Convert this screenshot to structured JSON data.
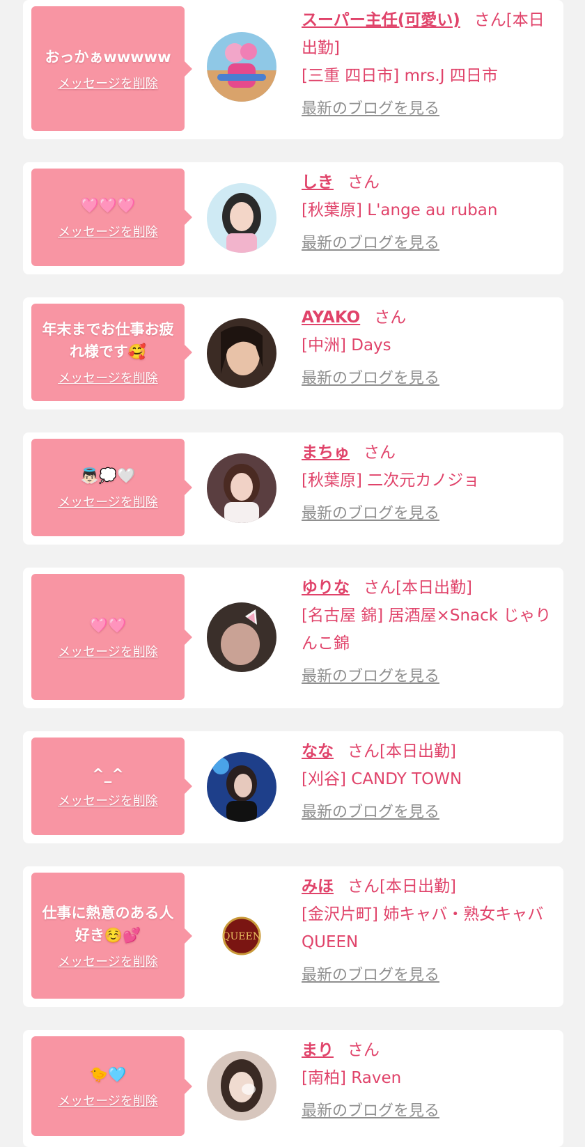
{
  "items": [
    {
      "message": "おっかぁwwwww",
      "delete_label": "メッセージを削除",
      "name": "スーパー主任(可愛い)",
      "honorific": "さん[本日出勤]",
      "shop": "[三重 四日市] mrs.J 四日市",
      "blog_label": "最新のブログを見る"
    },
    {
      "message": "🩷🩷🩷",
      "delete_label": "メッセージを削除",
      "name": "しき",
      "honorific": "さん",
      "shop": "[秋葉原] L'ange au ruban",
      "blog_label": "最新のブログを見る"
    },
    {
      "message": "年末までお仕事お疲れ様です🥰",
      "delete_label": "メッセージを削除",
      "name": "AYAKO",
      "honorific": "さん",
      "shop": "[中洲] Days",
      "blog_label": "最新のブログを見る"
    },
    {
      "message": "👼🏻💭🤍",
      "delete_label": "メッセージを削除",
      "name": "まちゅ",
      "honorific": "さん",
      "shop": "[秋葉原] 二次元カノジョ",
      "blog_label": "最新のブログを見る"
    },
    {
      "message": "🩷🩷",
      "delete_label": "メッセージを削除",
      "name": "ゆりな",
      "honorific": "さん[本日出勤]",
      "shop": "[名古屋 錦] 居酒屋×Snack じゃりんこ錦",
      "blog_label": "最新のブログを見る"
    },
    {
      "message": "^_^",
      "delete_label": "メッセージを削除",
      "name": "なな",
      "honorific": "さん[本日出勤]",
      "shop": "[刈谷] CANDY TOWN",
      "blog_label": "最新のブログを見る"
    },
    {
      "message": "仕事に熱意のある人好き☺️💕",
      "delete_label": "メッセージを削除",
      "name": "みほ",
      "honorific": "さん[本日出勤]",
      "shop": "[金沢片町] 姉キャバ・熟女キャバ QUEEN",
      "blog_label": "最新のブログを見る",
      "avatar_text": "QUEEN"
    },
    {
      "message": "🐤🩵",
      "delete_label": "メッセージを削除",
      "name": "まり",
      "honorific": "さん",
      "shop": "[南柏] Raven",
      "blog_label": "最新のブログを見る"
    }
  ]
}
